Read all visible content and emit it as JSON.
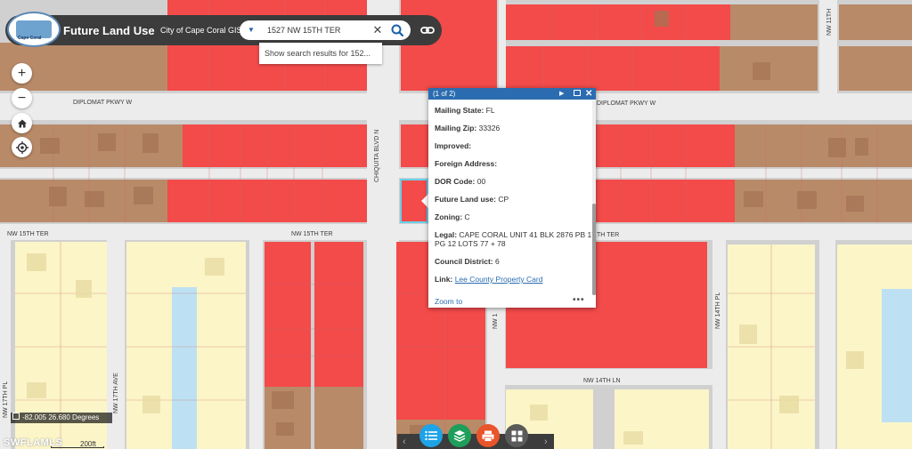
{
  "header": {
    "logo_text": "Cape Coral",
    "title": "Future Land Use",
    "subtitle": "City of Cape Coral GIS"
  },
  "search": {
    "value": "1527 NW 15TH TER",
    "suggestion": "Show search results for 152..."
  },
  "streets": {
    "diplomat_w": "DIPLOMAT PKWY W",
    "diplomat_e": "DIPLOMAT PKWY W",
    "nw15ter_w": "NW 15TH TER",
    "nw15ter_c": "NW 15TH TER",
    "nw15ter_e": "TH TER",
    "chiquita": "CHIQUITA BLVD N",
    "nw14ln": "NW 14TH LN",
    "nw14pl": "NW 14TH PL",
    "nw17pl": "NW 17TH PL",
    "nw17ave": "NW 17TH AVE",
    "nw11th": "NW 11TH",
    "nw1": "NW 1"
  },
  "popup": {
    "count": "(1 of 2)",
    "fields": [
      {
        "label": "Mailing State:",
        "value": "FL"
      },
      {
        "label": "Mailing Zip:",
        "value": "33326"
      },
      {
        "label": "Improved:",
        "value": ""
      },
      {
        "label": "Foreign Address:",
        "value": ""
      },
      {
        "label": "DOR Code:",
        "value": "00"
      },
      {
        "label": "Future Land use:",
        "value": "CP"
      },
      {
        "label": "Zoning:",
        "value": "C"
      }
    ],
    "legal_label": "Legal:",
    "legal_line1": "CAPE CORAL UNIT 41 BLK 2876 PB 17",
    "legal_line2": "PG 12 LOTS 77 + 78",
    "council_label": "Council District:",
    "council_value": "6",
    "link_label": "Link:",
    "link_text": "Lee County Property Card",
    "zoom_to": "Zoom to",
    "more": "•••"
  },
  "status": {
    "coords": "-82.005 26.680 Degrees",
    "watermark": "SWFLAMLS",
    "scale": "200ft"
  },
  "colors": {
    "commercial": "#f34a4a",
    "residential": "#fbf5c8",
    "brown": "#b98a68",
    "water": "#bde1f2",
    "road": "#ececec",
    "accent": "#2b6cb0"
  },
  "icons": {
    "zoom_in": "plus-icon",
    "zoom_out": "minus-icon",
    "home": "home-icon",
    "locate": "locate-icon",
    "search": "search-icon",
    "link": "link-icon",
    "list": "list-icon",
    "layers": "layers-icon",
    "print": "print-icon",
    "basemap": "grid-icon"
  }
}
